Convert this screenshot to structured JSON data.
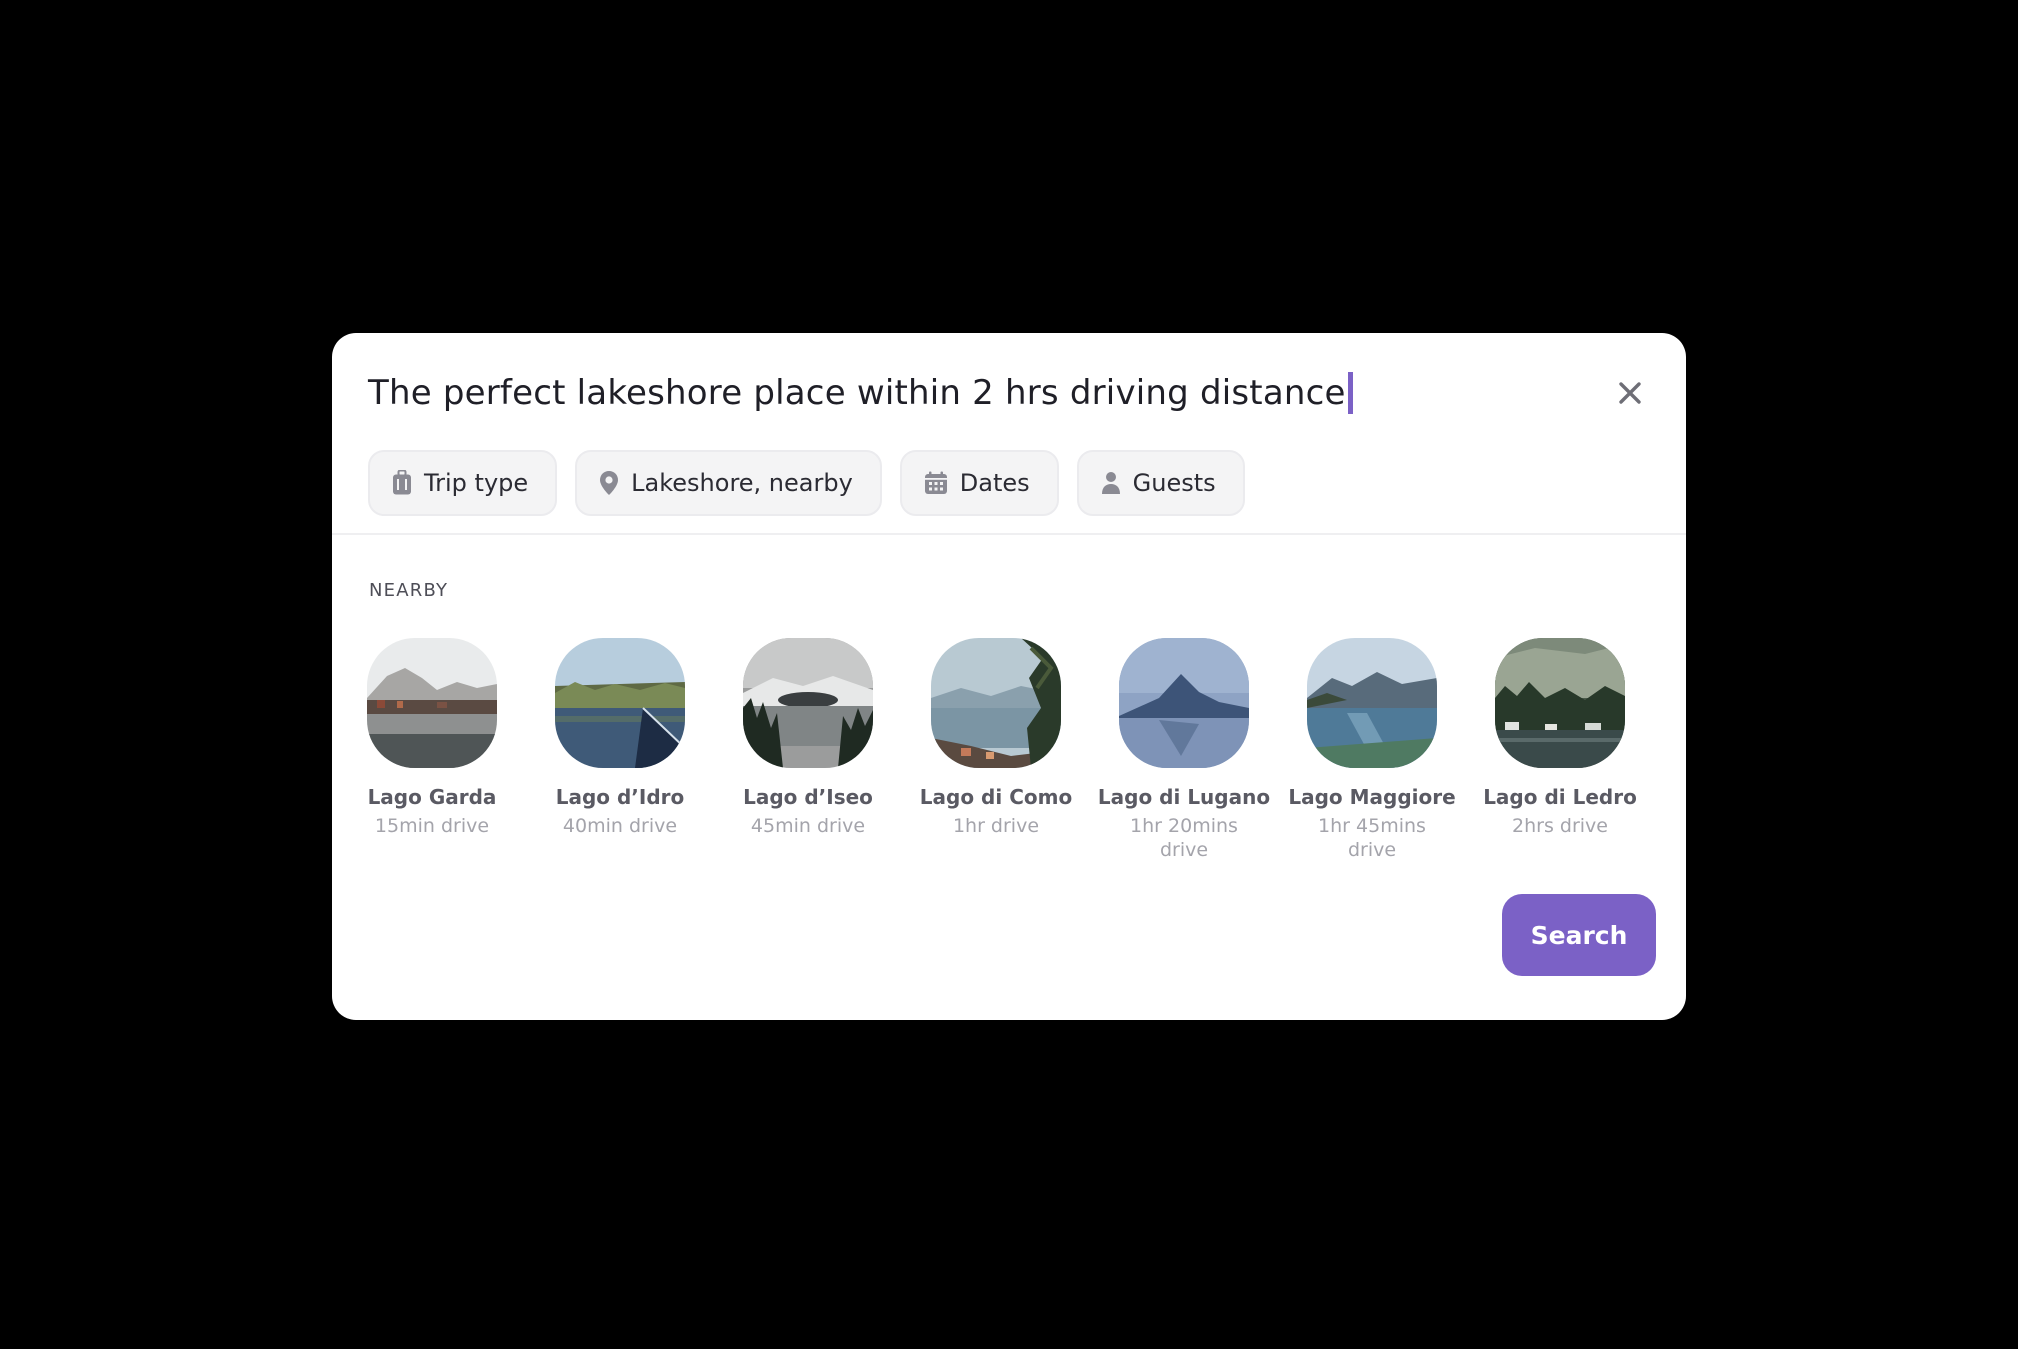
{
  "query": {
    "text": "The perfect lakeshore place within 2 hrs driving distance"
  },
  "close_icon": "close-icon",
  "filters": [
    {
      "label": "Trip type",
      "icon": "luggage-icon"
    },
    {
      "label": "Lakeshore, nearby",
      "icon": "map-pin-icon"
    },
    {
      "label": "Dates",
      "icon": "calendar-icon"
    },
    {
      "label": "Guests",
      "icon": "person-icon"
    }
  ],
  "nearby": {
    "heading": "NEARBY",
    "places": [
      {
        "name": "Lago Garda",
        "distance": "15min drive"
      },
      {
        "name": "Lago d’Idro",
        "distance": "40min drive"
      },
      {
        "name": "Lago d’Iseo",
        "distance": "45min drive"
      },
      {
        "name": "Lago di Como",
        "distance": "1hr drive"
      },
      {
        "name": "Lago di Lugano",
        "distance": "1hr 20mins drive"
      },
      {
        "name": "Lago Maggiore",
        "distance": "1hr 45mins drive"
      },
      {
        "name": "Lago di Ledro",
        "distance": "2hrs drive"
      }
    ]
  },
  "search": {
    "label": "Search"
  },
  "colors": {
    "accent": "#7b61c6",
    "background": "#000000",
    "panel": "#ffffff",
    "chip_bg": "#f4f4f5"
  }
}
